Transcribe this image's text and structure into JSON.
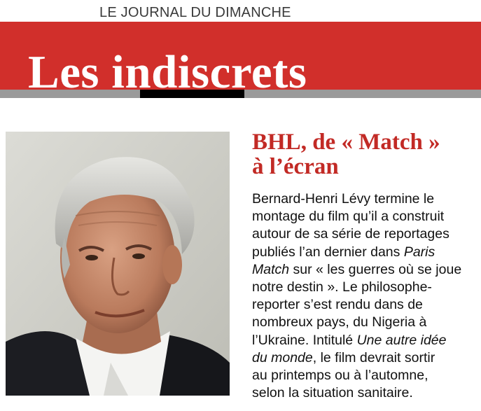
{
  "masthead": {
    "publication": "LE JOURNAL DU DIMANCHE"
  },
  "banner": {
    "title": "Les indiscrets"
  },
  "colors": {
    "banner_red": "#d12f2b",
    "headline_red": "#c22a25",
    "rule_gray": "#9a9a9a",
    "rule_black": "#000000"
  },
  "article": {
    "headline_lines": [
      "BHL, de « Match »",
      "à l’écran"
    ],
    "body": {
      "line1": "Bernard-Henri Lévy termine le",
      "line2": "montage du film qu’il a construit",
      "line3": "autour de sa série de reportages",
      "line4_a": "publiés l’an dernier dans ",
      "line4_b": "Paris",
      "line5_a": "Match",
      "line5_b": " sur « les guerres où se joue",
      "line6": "notre destin ». Le philosophe-",
      "line7": "reporter s’est rendu dans de",
      "line8": "nombreux pays, du Nigeria à",
      "line9_a": "l’Ukraine. Intitulé ",
      "line9_b": "Une autre idée",
      "line10_a": "du monde",
      "line10_b": ", le film devrait sortir",
      "line11": "au printemps ou à l’automne,",
      "line12": "selon la situation sanitaire."
    },
    "photo": {
      "subject": "portrait-photo"
    }
  }
}
